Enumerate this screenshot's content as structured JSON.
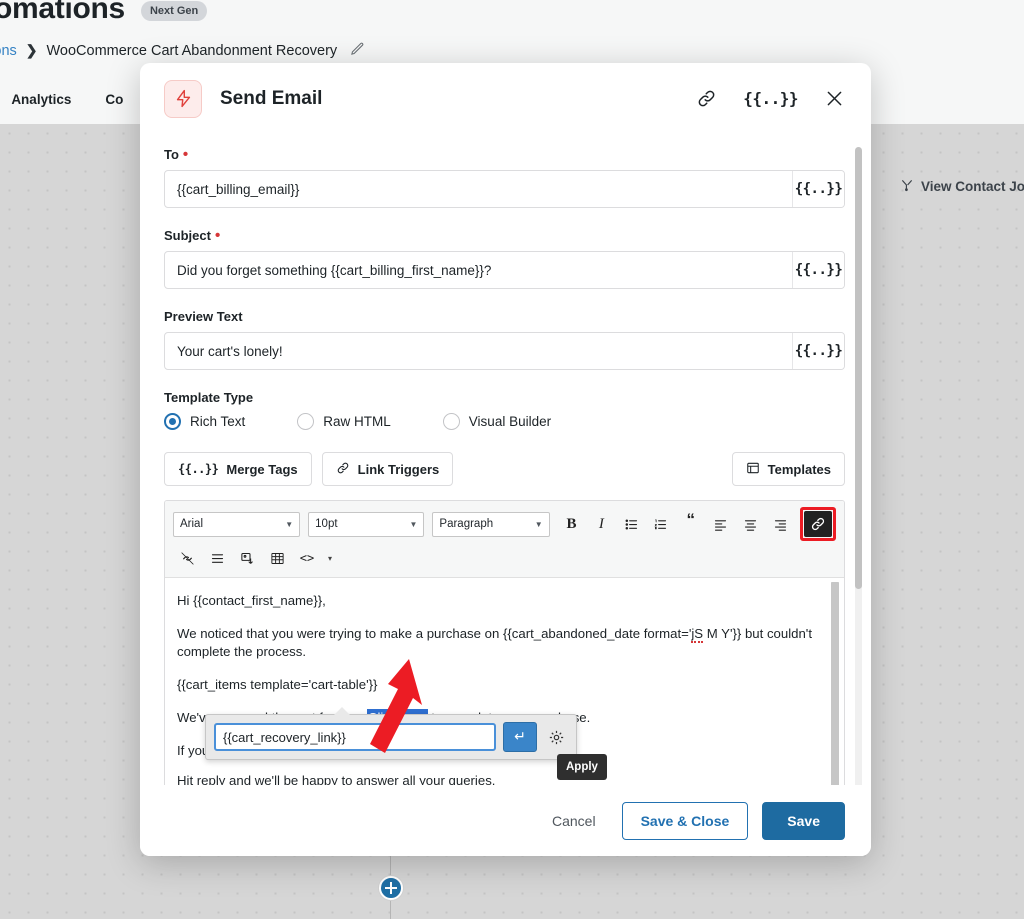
{
  "page": {
    "title": "omations",
    "badge": "Next Gen",
    "breadcrumb": {
      "root": "nations",
      "separator": "›",
      "current": "WooCommerce Cart Abandonment Recovery",
      "edit_icon": "pencil-icon"
    },
    "tabs": [
      {
        "label": "✔",
        "active": true
      },
      {
        "label": "Analytics",
        "active": false
      },
      {
        "label": "Co",
        "active": false
      }
    ],
    "view_journey": "View Contact Jou",
    "add_node_icon": "plus-icon"
  },
  "modal": {
    "icon": "lightning-bolt-icon",
    "title": "Send Email",
    "header_actions": [
      {
        "name": "link-icon",
        "glyph": "link"
      },
      {
        "name": "merge-tags-icon",
        "glyph": "{{..}}"
      },
      {
        "name": "close-icon",
        "glyph": "✕"
      }
    ],
    "fields": {
      "to": {
        "label": "To",
        "required": true,
        "value": "{{cart_billing_email}}",
        "placeholder": "",
        "tag_button": "{{..}}"
      },
      "subject": {
        "label": "Subject",
        "required": true,
        "value": "Did you forget something {{cart_billing_first_name}}?",
        "placeholder": "",
        "tag_button": "{{..}}"
      },
      "preview_text": {
        "label": "Preview Text",
        "required": false,
        "value": "Your cart's lonely!",
        "placeholder": "",
        "tag_button": "{{..}}"
      }
    },
    "template_type": {
      "label": "Template Type",
      "options": [
        {
          "label": "Rich Text",
          "checked": true
        },
        {
          "label": "Raw HTML",
          "checked": false
        },
        {
          "label": "Visual Builder",
          "checked": false
        }
      ]
    },
    "action_buttons": {
      "merge_tags": "Merge Tags",
      "link_triggers": "Link Triggers",
      "templates": "Templates"
    },
    "editor": {
      "toolbar": {
        "font_family": "Arial",
        "font_size": "10pt",
        "block_format": "Paragraph",
        "bold": "B",
        "italic": "I",
        "bullet_list": "bullet-list-icon",
        "numbered_list": "numbered-list-icon",
        "blockquote": "“",
        "align_left": "align-left-icon",
        "align_center": "align-center-icon",
        "align_right": "align-right-icon",
        "insert_link": "link-icon",
        "unlink": "unlink-icon",
        "horizontal_rule": "horizontal-rule-icon",
        "insert_image": "insert-image-icon",
        "insert_table": "insert-table-icon",
        "source_code": "<>",
        "more_caret": "▾"
      },
      "body": {
        "greeting": "Hi {{contact_first_name}},",
        "paragraph_1_pre": "We noticed that you were trying to make a purchase on {{cart_abandoned_date format='",
        "paragraph_1_spell": "jS",
        "paragraph_1_post": " M Y'}} but couldn't complete the process.",
        "cart_items": "{{cart_items template='cart-table'}}",
        "reserved_pre": "We've reserved the cart for you. ",
        "reserved_link": "Click here",
        "reserved_post": " to complete your purchase.",
        "if_you": "If you",
        "hit_reply": "Hit reply and we'll be happy to answer all your queries.",
        "dash": "-"
      },
      "link_popup": {
        "url_value": "{{cart_recovery_link}}",
        "apply_icon": "↵",
        "settings_icon": "gear-icon",
        "tooltip": "Apply"
      }
    },
    "footer": {
      "cancel": "Cancel",
      "save_and_close": "Save & Close",
      "save": "Save"
    }
  },
  "colors": {
    "primary": "#2271b1",
    "save_button": "#1e6ba1",
    "required": "#d63638",
    "annotation_arrow": "#ec1c24",
    "selection": "#2f6fd0"
  }
}
